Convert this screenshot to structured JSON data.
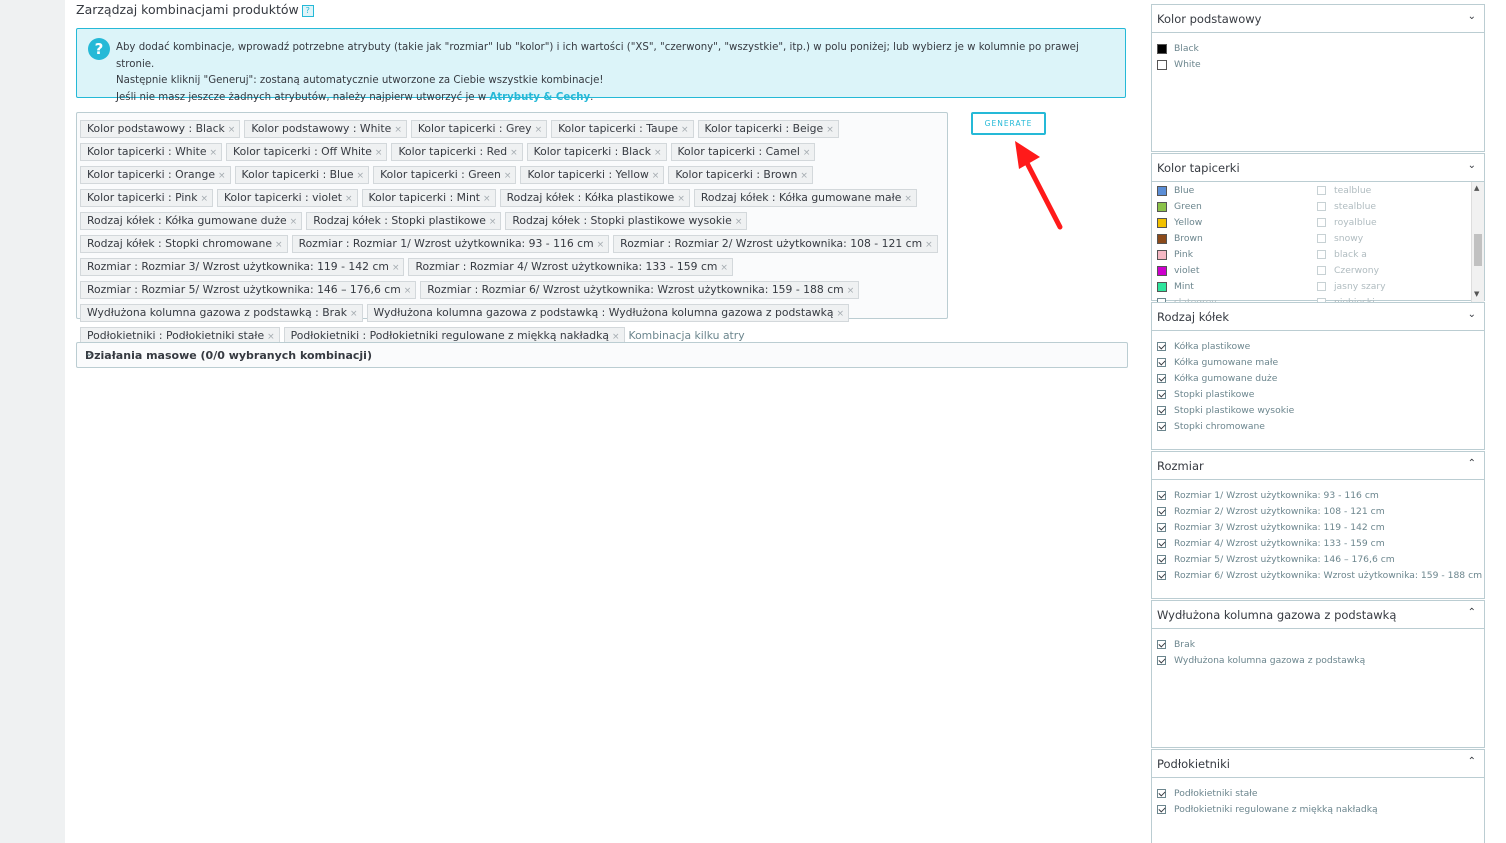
{
  "header": {
    "title": "Zarządzaj kombinacjami produktów"
  },
  "alert": {
    "line1": "Aby dodać kombinacje, wprowadź potrzebne atrybuty (takie jak \"rozmiar\" lub \"kolor\") i ich wartości (\"XS\", \"czerwony\", \"wszystkie\", itp.) w polu poniżej; lub wybierz je w kolumnie po prawej stronie.",
    "line2": "Następnie kliknij \"Generuj\": zostaną automatycznie utworzone za Ciebie wszystkie kombinacje!",
    "line3_prefix": "Jeśli nie masz jeszcze żadnych atrybutów, należy najpierw utworzyć je w ",
    "line3_link": "Atrybuty & Cechy",
    "line3_suffix": "."
  },
  "tags": [
    "Kolor podstawowy : Black",
    "Kolor podstawowy : White",
    "Kolor tapicerki : Grey",
    "Kolor tapicerki : Taupe",
    "Kolor tapicerki : Beige",
    "Kolor tapicerki : White",
    "Kolor tapicerki : Off White",
    "Kolor tapicerki : Red",
    "Kolor tapicerki : Black",
    "Kolor tapicerki : Camel",
    "Kolor tapicerki : Orange",
    "Kolor tapicerki : Blue",
    "Kolor tapicerki : Green",
    "Kolor tapicerki : Yellow",
    "Kolor tapicerki : Brown",
    "Kolor tapicerki : Pink",
    "Kolor tapicerki : violet",
    "Kolor tapicerki : Mint",
    "Rodzaj kółek : Kółka plastikowe",
    "Rodzaj kółek : Kółka gumowane małe",
    "Rodzaj kółek : Kółka gumowane duże",
    "Rodzaj kółek : Stopki plastikowe",
    "Rodzaj kółek : Stopki plastikowe wysokie",
    "Rodzaj kółek : Stopki chromowane",
    "Rozmiar : Rozmiar 1/ Wzrost użytkownika: 93 - 116 cm",
    "Rozmiar : Rozmiar 2/ Wzrost użytkownika: 108 - 121 cm",
    "Rozmiar : Rozmiar 3/ Wzrost użytkownika: 119 - 142 cm",
    "Rozmiar : Rozmiar 4/ Wzrost użytkownika: 133 - 159 cm",
    "Rozmiar : Rozmiar 5/ Wzrost użytkownika: 146 – 176,6 cm",
    "Rozmiar : Rozmiar 6/ Wzrost użytkownika: Wzrost użytkownika: 159 - 188 cm",
    "Wydłużona kolumna gazowa z podstawką : Brak",
    "Wydłużona kolumna gazowa z podstawką : Wydłużona kolumna gazowa z podstawką",
    "Podłokietniki : Podłokietniki stałe",
    "Podłokietniki : Podłokietniki regulowane z miękką nakładką"
  ],
  "tag_input": {
    "placeholder": "Kombinacja kilku atry"
  },
  "generate_label": "GENERATE",
  "bulk": {
    "label": "Działania masowe (0/0 wybranych kombinacji)"
  },
  "panels": {
    "kolor_podstawowy": {
      "title": "Kolor podstawowy",
      "items": [
        {
          "label": "Black",
          "color": "#000000"
        },
        {
          "label": "White",
          "color": "#ffffff"
        }
      ]
    },
    "kolor_tapicerki": {
      "title": "Kolor tapicerki",
      "col1": [
        {
          "label": "Blue",
          "color": "#5b8ed6"
        },
        {
          "label": "Green",
          "color": "#8bc34a"
        },
        {
          "label": "Yellow",
          "color": "#f2c100"
        },
        {
          "label": "Brown",
          "color": "#8b4a1a"
        },
        {
          "label": "Pink",
          "color": "#f5b8c4"
        },
        {
          "label": "violet",
          "color": "#cc00cc"
        },
        {
          "label": "Mint",
          "color": "#2ee59d"
        },
        {
          "label": "slategrey",
          "color": ""
        }
      ],
      "col2": [
        "tealblue",
        "stealblue",
        "royalblue",
        "snowy",
        "black a",
        "Czerwony",
        "jasny szary",
        "niebieski"
      ]
    },
    "rodzaj_kolek": {
      "title": "Rodzaj kółek",
      "items": [
        "Kółka plastikowe",
        "Kółka gumowane małe",
        "Kółka gumowane duże",
        "Stopki plastikowe",
        "Stopki plastikowe wysokie",
        "Stopki chromowane"
      ]
    },
    "rozmiar": {
      "title": "Rozmiar",
      "items": [
        "Rozmiar 1/ Wzrost użytkownika: 93 - 116 cm",
        "Rozmiar 2/ Wzrost użytkownika: 108 - 121 cm",
        "Rozmiar 3/ Wzrost użytkownika: 119 - 142 cm",
        "Rozmiar 4/ Wzrost użytkownika: 133 - 159 cm",
        "Rozmiar 5/ Wzrost użytkownika: 146 – 176,6 cm",
        "Rozmiar 6/ Wzrost użytkownika: Wzrost użytkownika: 159 - 188 cm"
      ]
    },
    "kolumna": {
      "title": "Wydłużona kolumna gazowa z podstawką",
      "items": [
        "Brak",
        "Wydłużona kolumna gazowa z podstawką"
      ]
    },
    "podlokietniki": {
      "title": "Podłokietniki",
      "items": [
        "Podłokietniki stałe",
        "Podłokietniki regulowane z miękką nakładką"
      ]
    }
  },
  "colors": {
    "accent": "#25b9d7",
    "alert_bg": "#dcf4f9",
    "arrow": "#ff0000"
  }
}
